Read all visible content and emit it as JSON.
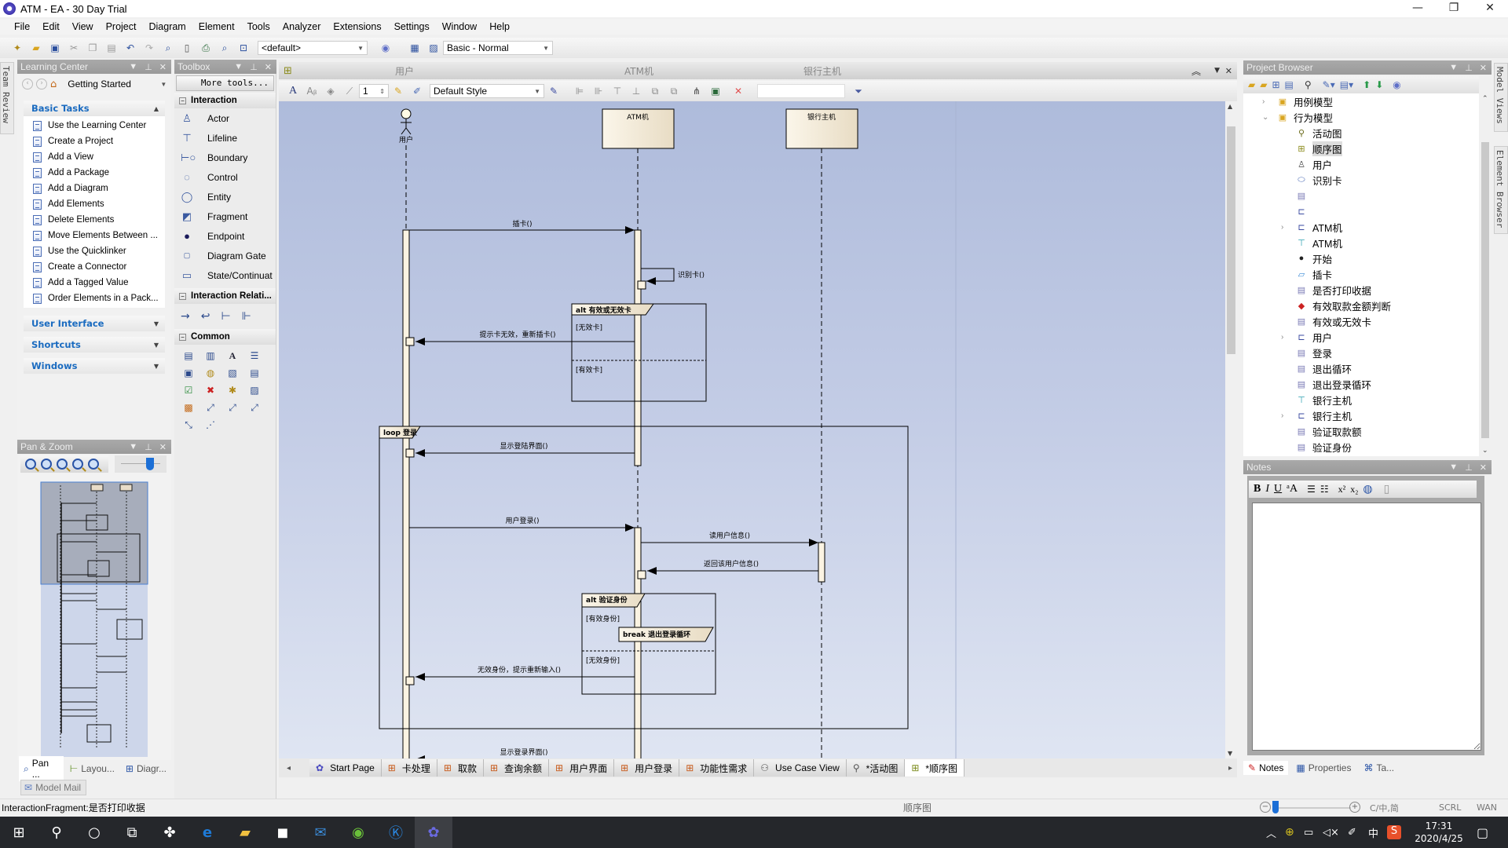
{
  "window": {
    "title": "ATM - EA - 30 Day Trial",
    "controls": [
      "—",
      "❐",
      "✕"
    ]
  },
  "menu": [
    "File",
    "Edit",
    "View",
    "Project",
    "Diagram",
    "Element",
    "Tools",
    "Analyzer",
    "Extensions",
    "Settings",
    "Window",
    "Help"
  ],
  "toolbar": {
    "workspace_value": "<default>",
    "perspective_value": "Basic - Normal"
  },
  "learning_center": {
    "title": "Learning Center",
    "nav_value": "Getting Started",
    "sections": [
      {
        "label": "Basic Tasks",
        "expanded": true,
        "items": [
          "Use the Learning Center",
          "Create a Project",
          "Add a View",
          "Add a Package",
          "Add a Diagram",
          "Add Elements",
          "Delete Elements",
          "Move Elements Between ...",
          "Use the Quicklinker",
          "Create a Connector",
          "Add a Tagged Value",
          "Order Elements in a Pack..."
        ]
      },
      {
        "label": "User Interface",
        "expanded": false
      },
      {
        "label": "Shortcuts",
        "expanded": false
      },
      {
        "label": "Windows",
        "expanded": false
      }
    ]
  },
  "side_tabs": {
    "left": "Team Review",
    "right_top": "Model Views",
    "right_bottom": "Element Browser"
  },
  "toolbox": {
    "title": "Toolbox",
    "more_tools": "More tools...",
    "interaction_label": "Interaction",
    "interaction_items": [
      {
        "label": "Actor",
        "icon": "actor-icon"
      },
      {
        "label": "Lifeline",
        "icon": "lifeline-icon"
      },
      {
        "label": "Boundary",
        "icon": "boundary-icon"
      },
      {
        "label": "Control",
        "icon": "control-icon"
      },
      {
        "label": "Entity",
        "icon": "entity-icon"
      },
      {
        "label": "Fragment",
        "icon": "fragment-icon"
      },
      {
        "label": "Endpoint",
        "icon": "endpoint-icon"
      },
      {
        "label": "Diagram Gate",
        "icon": "diagram-gate-icon"
      },
      {
        "label": "State/Continuat",
        "icon": "state-continuation-icon"
      }
    ],
    "relations_label": "Interaction Relati...",
    "common_label": "Common"
  },
  "pan_zoom": {
    "title": "Pan & Zoom",
    "tabs": [
      "Pan ...",
      "Layou...",
      "Diagr..."
    ],
    "model_mail": "Model Mail"
  },
  "diagram": {
    "header_lifelines": [
      "用户",
      "ATM机",
      "银行主机"
    ],
    "style_value": "Default Style",
    "line_width_value": "1",
    "lifelines": [
      {
        "name": "用户",
        "kind": "actor"
      },
      {
        "name": "ATM机",
        "kind": "object"
      },
      {
        "name": "银行主机",
        "kind": "object"
      }
    ],
    "messages": [
      {
        "label": "插卡()",
        "from": "用户",
        "to": "ATM机"
      },
      {
        "label": "识别卡()",
        "from": "ATM机",
        "to": "ATM机"
      },
      {
        "label": "提示卡无效，重新插卡()",
        "from": "ATM机",
        "to": "用户"
      },
      {
        "label": "显示登陆界面()",
        "from": "ATM机",
        "to": "用户"
      },
      {
        "label": "用户登录()",
        "from": "用户",
        "to": "ATM机"
      },
      {
        "label": "读用户信息()",
        "from": "ATM机",
        "to": "银行主机"
      },
      {
        "label": "返回该用户信息()",
        "from": "银行主机",
        "to": "ATM机"
      },
      {
        "label": "无效身份，提示重新输入()",
        "from": "ATM机",
        "to": "用户"
      },
      {
        "label": "显示登录界面()",
        "from": "ATM机",
        "to": "用户"
      }
    ],
    "fragments": [
      {
        "label": "alt 有效或无效卡",
        "guards": [
          "[无效卡]",
          "[有效卡]"
        ]
      },
      {
        "label": "loop 登录",
        "guards": []
      },
      {
        "label": "alt 验证身份",
        "guards": [
          "[有效身份]",
          "[无效身份]"
        ]
      },
      {
        "label": "break 退出登录循环",
        "guards": []
      }
    ]
  },
  "diagram_tabs": [
    {
      "label": "Start Page",
      "icon": "start-page-icon"
    },
    {
      "label": "卡处理",
      "icon": "package-diagram-icon"
    },
    {
      "label": "取款",
      "icon": "package-diagram-icon"
    },
    {
      "label": "查询余额",
      "icon": "package-diagram-icon"
    },
    {
      "label": "用户界面",
      "icon": "package-diagram-icon"
    },
    {
      "label": "用户登录",
      "icon": "package-diagram-icon"
    },
    {
      "label": "功能性需求",
      "icon": "package-diagram-icon"
    },
    {
      "label": "Use Case View",
      "icon": "use-case-icon"
    },
    {
      "label": "*活动图",
      "icon": "activity-icon"
    },
    {
      "label": "*顺序图",
      "icon": "sequence-icon",
      "active": true
    }
  ],
  "project_browser": {
    "title": "Project Browser",
    "tree": [
      {
        "label": "用例模型",
        "level": 0,
        "expander": "›",
        "icon": "package-icon"
      },
      {
        "label": "行为模型",
        "level": 0,
        "expander": "⌄",
        "icon": "package-icon"
      },
      {
        "label": "活动图",
        "level": 1,
        "icon": "activity-diagram-icon"
      },
      {
        "label": "顺序图",
        "level": 1,
        "icon": "sequence-diagram-icon",
        "selected": true
      },
      {
        "label": "用户",
        "level": 1,
        "icon": "actor-icon"
      },
      {
        "label": "识别卡",
        "level": 1,
        "icon": "use-case-icon"
      },
      {
        "label": "",
        "level": 1,
        "icon": "fragment-icon"
      },
      {
        "label": "",
        "level": 1,
        "icon": "class-icon"
      },
      {
        "label": "ATM机",
        "level": 1,
        "expander": "›",
        "icon": "class-icon"
      },
      {
        "label": "ATM机",
        "level": 1,
        "icon": "lifeline-icon"
      },
      {
        "label": "开始",
        "level": 1,
        "icon": "initial-node-icon"
      },
      {
        "label": "插卡",
        "level": 1,
        "icon": "send-signal-icon"
      },
      {
        "label": "是否打印收据",
        "level": 1,
        "icon": "fragment-icon"
      },
      {
        "label": "有效取款金额判断",
        "level": 1,
        "icon": "decision-icon"
      },
      {
        "label": "有效或无效卡",
        "level": 1,
        "icon": "fragment-icon"
      },
      {
        "label": "用户",
        "level": 1,
        "expander": "›",
        "icon": "class-icon"
      },
      {
        "label": "登录",
        "level": 1,
        "icon": "fragment-icon"
      },
      {
        "label": "退出循环",
        "level": 1,
        "icon": "fragment-icon"
      },
      {
        "label": "退出登录循环",
        "level": 1,
        "icon": "fragment-icon"
      },
      {
        "label": "银行主机",
        "level": 1,
        "icon": "lifeline-icon"
      },
      {
        "label": "银行主机",
        "level": 1,
        "expander": "›",
        "icon": "class-icon"
      },
      {
        "label": "验证取款额",
        "level": 1,
        "icon": "fragment-icon"
      },
      {
        "label": "验证身份",
        "level": 1,
        "icon": "fragment-icon"
      }
    ]
  },
  "notes": {
    "title": "Notes",
    "value": "",
    "tabs": [
      "Notes",
      "Properties",
      "Ta..."
    ]
  },
  "status": {
    "message": "InteractionFragment:是否打印收据",
    "center": "顺序图",
    "indicators": [
      "C/中,简",
      "SCRL",
      "WAN"
    ]
  },
  "taskbar": {
    "time": "17:31",
    "date": "2020/4/25",
    "ime": "中"
  }
}
